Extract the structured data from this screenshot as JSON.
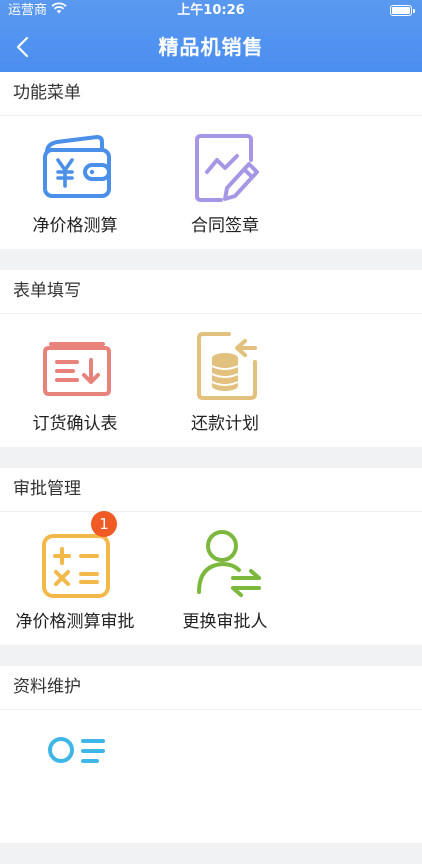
{
  "status_bar": {
    "carrier": "运营商",
    "time": "上午10:26"
  },
  "nav": {
    "title": "精品机销售"
  },
  "sections": [
    {
      "title": "功能菜单",
      "items": [
        {
          "label": "净价格测算",
          "icon": "wallet-yen-icon"
        },
        {
          "label": "合同签章",
          "icon": "contract-sign-icon"
        }
      ]
    },
    {
      "title": "表单填写",
      "items": [
        {
          "label": "订货确认表",
          "icon": "order-confirm-icon"
        },
        {
          "label": "还款计划",
          "icon": "repayment-plan-icon"
        }
      ]
    },
    {
      "title": "审批管理",
      "items": [
        {
          "label": "净价格测算审批",
          "icon": "calculator-icon",
          "badge": "1"
        },
        {
          "label": "更换审批人",
          "icon": "change-approver-icon"
        }
      ]
    },
    {
      "title": "资料维护",
      "items": [
        {
          "label": "",
          "icon": "profile-list-icon"
        }
      ]
    }
  ],
  "colors": {
    "header": "#4a8ef0",
    "badge": "#f05a24"
  }
}
